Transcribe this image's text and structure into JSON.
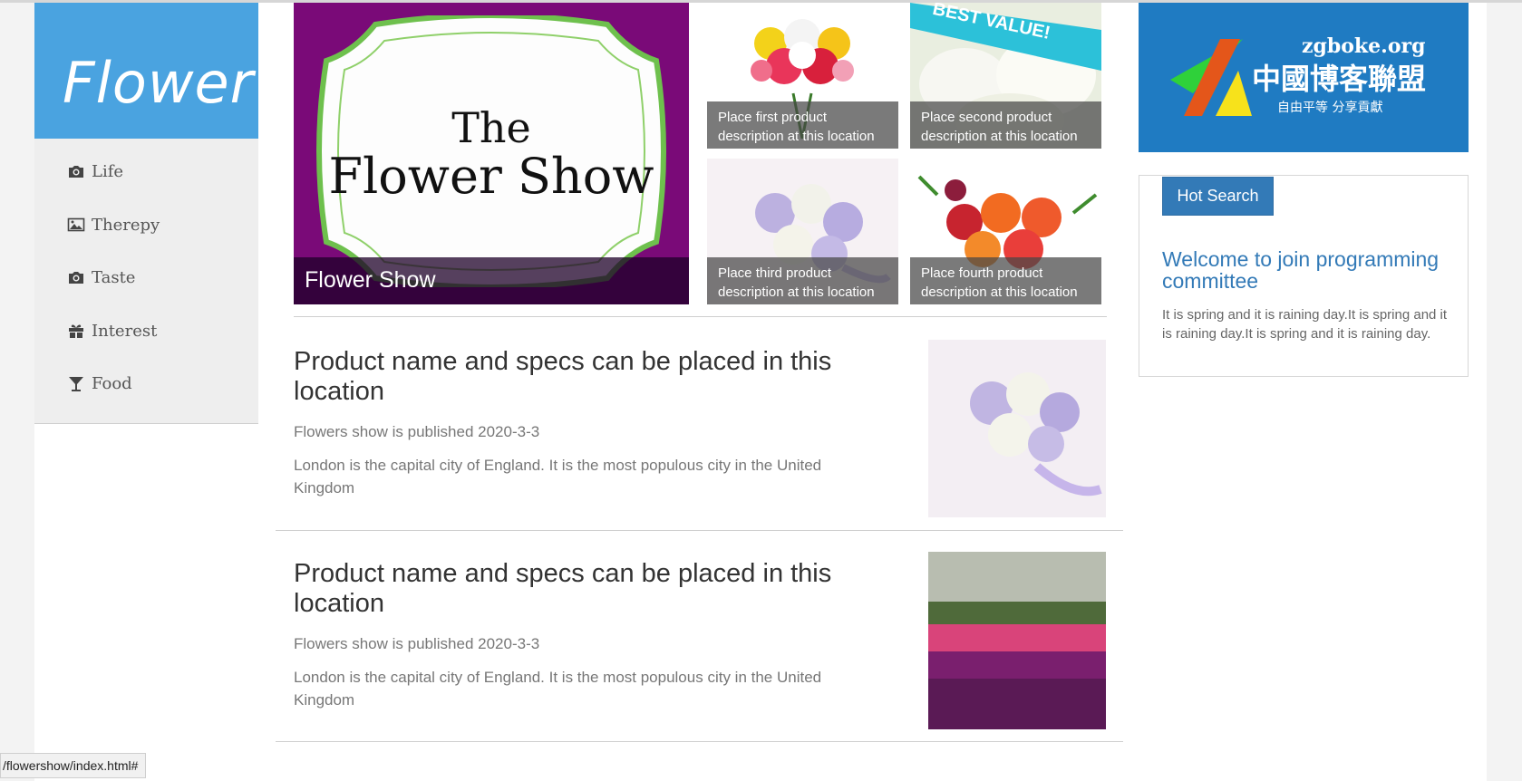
{
  "brand": {
    "name": "Flower",
    "color": "#4aa3e0"
  },
  "sidebar": {
    "items": [
      {
        "label": "Life",
        "icon": "camera-icon"
      },
      {
        "label": "Therepy",
        "icon": "picture-icon"
      },
      {
        "label": "Taste",
        "icon": "camera-icon"
      },
      {
        "label": "Interest",
        "icon": "gift-icon"
      },
      {
        "label": "Food",
        "icon": "cocktail-icon"
      }
    ]
  },
  "hero": {
    "banner_line1": "The",
    "banner_line2": "Flower Show",
    "caption": "Flower Show"
  },
  "tiles": [
    {
      "caption": "Place first product description at this location"
    },
    {
      "caption": "Place second product description at this location",
      "badge": "BEST VALUE!"
    },
    {
      "caption": "Place third product description at this location"
    },
    {
      "caption": "Place fourth product description at this location"
    }
  ],
  "tile_badge": "BEST VALUE!",
  "articles": [
    {
      "title": "Product name and specs can be placed in this location",
      "meta": "Flowers show is published 2020-3-3",
      "desc": "London is the capital city of England. It is the most populous city in the United Kingdom"
    },
    {
      "title": "Product name and specs can be placed in this location",
      "meta": "Flowers show is published 2020-3-3",
      "desc": "London is the capital city of England. It is the most populous city in the United Kingdom"
    }
  ],
  "ad": {
    "site": "zgboke.org",
    "name": "中國博客聯盟",
    "slogan": "自由平等  分享貢獻"
  },
  "hot_search": {
    "button": "Hot Search",
    "link": "Welcome to join programming committee",
    "text": "It is spring and it is raining day.It is spring and it is raining day.It is spring and it is raining day."
  },
  "status_bar": {
    "url": "/flowershow/index.html#"
  }
}
